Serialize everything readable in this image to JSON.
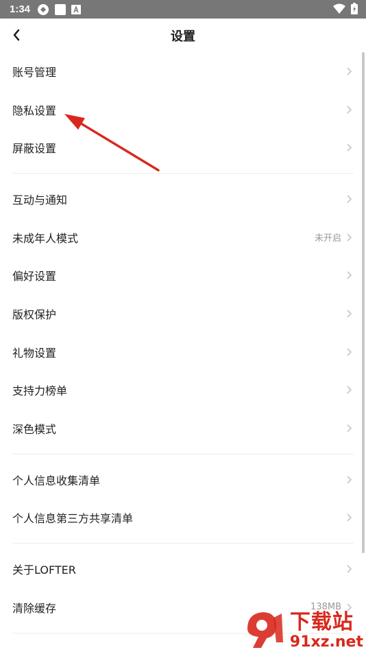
{
  "status_bar": {
    "time": "1:34"
  },
  "header": {
    "title": "设置"
  },
  "settings": {
    "group1": [
      {
        "label": "账号管理"
      },
      {
        "label": "隐私设置"
      },
      {
        "label": "屏蔽设置"
      }
    ],
    "group2": [
      {
        "label": "互动与通知"
      },
      {
        "label": "未成年人模式",
        "value": "未开启"
      },
      {
        "label": "偏好设置"
      },
      {
        "label": "版权保护"
      },
      {
        "label": "礼物设置"
      },
      {
        "label": "支持力榜单"
      },
      {
        "label": "深色模式"
      }
    ],
    "group3": [
      {
        "label": "个人信息收集清单"
      },
      {
        "label": "个人信息第三方共享清单"
      }
    ],
    "group4": [
      {
        "label": "关于LOFTER"
      },
      {
        "label": "清除缓存",
        "value": "138MB"
      }
    ]
  },
  "watermark": {
    "line1": "下载站",
    "line2": "91xz.net"
  },
  "colors": {
    "arrow": "#d8281d",
    "status_bar": "#777777",
    "chevron": "#c4c4c4"
  }
}
